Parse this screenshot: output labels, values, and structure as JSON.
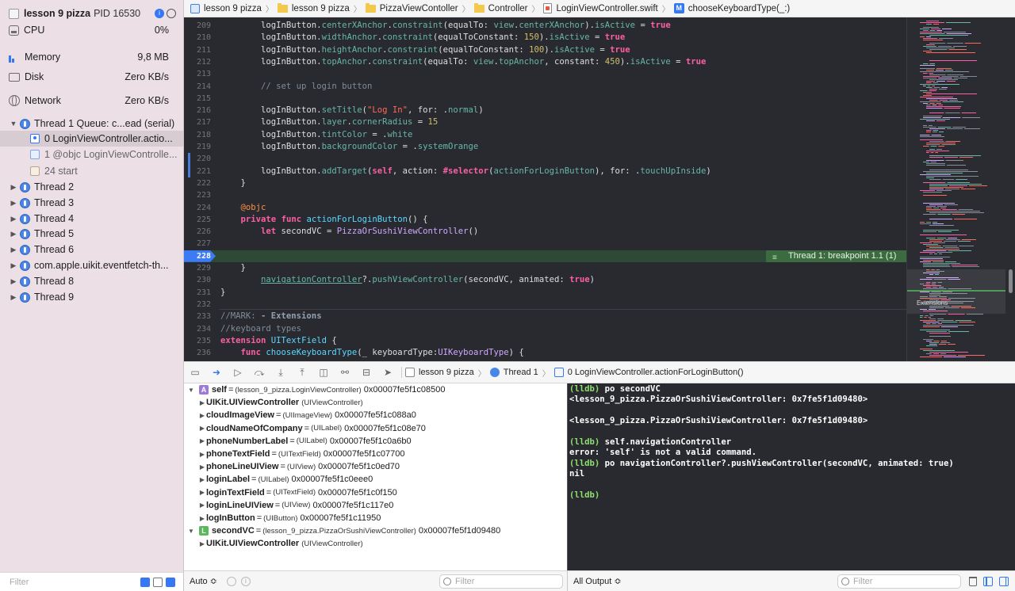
{
  "process": {
    "name": "lesson 9 pizza",
    "pid": "PID 16530"
  },
  "gauges": [
    {
      "label": "CPU",
      "value": "0%"
    },
    {
      "label": "Memory",
      "value": "9,8 MB"
    },
    {
      "label": "Disk",
      "value": "Zero KB/s"
    },
    {
      "label": "Network",
      "value": "Zero KB/s"
    }
  ],
  "threads": {
    "thread1": "Thread 1 Queue: c...ead (serial)",
    "frames": [
      "0 LoginViewController.actio...",
      "1 @objc LoginViewControlle...",
      "24 start"
    ],
    "others": [
      "Thread 2",
      "Thread 3",
      "Thread 4",
      "Thread 5",
      "Thread 6",
      "com.apple.uikit.eventfetch-th...",
      "Thread 8",
      "Thread 9"
    ]
  },
  "navigator_filter": {
    "placeholder": "Filter"
  },
  "jumpbar": {
    "items": [
      "lesson 9 pizza",
      "lesson 9 pizza",
      "PizzaViewContoller",
      "Controller",
      "LoginViewController.swift",
      "chooseKeyboardType(_:)"
    ]
  },
  "breakpoint": {
    "line": "228",
    "label": "Thread 1: breakpoint 1.1 (1)"
  },
  "code_lines": [
    {
      "n": "209",
      "t": "        logInButton.centerXAnchor.constraint(equalTo: view.centerXAnchor).isActive = true"
    },
    {
      "n": "210",
      "t": "        logInButton.widthAnchor.constraint(equalToConstant: 150).isActive = true"
    },
    {
      "n": "211",
      "t": "        logInButton.heightAnchor.constraint(equalToConstant: 100).isActive = true"
    },
    {
      "n": "212",
      "t": "        logInButton.topAnchor.constraint(equalTo: view.topAnchor, constant: 450).isActive = true"
    },
    {
      "n": "213",
      "t": ""
    },
    {
      "n": "214",
      "t": "        // set up login button"
    },
    {
      "n": "215",
      "t": ""
    },
    {
      "n": "216",
      "t": "        logInButton.setTitle(\"Log In\", for: .normal)"
    },
    {
      "n": "217",
      "t": "        logInButton.layer.cornerRadius = 15"
    },
    {
      "n": "218",
      "t": "        logInButton.tintColor = .white"
    },
    {
      "n": "219",
      "t": "        logInButton.backgroundColor = .systemOrange"
    },
    {
      "n": "220",
      "t": ""
    },
    {
      "n": "221",
      "t": "        logInButton.addTarget(self, action: #selector(actionForLoginButton), for: .touchUpInside)"
    },
    {
      "n": "222",
      "t": "    }"
    },
    {
      "n": "223",
      "t": ""
    },
    {
      "n": "224",
      "t": "    @objc"
    },
    {
      "n": "225",
      "t": "    private func actionForLoginButton() {"
    },
    {
      "n": "226",
      "t": "        let secondVC = PizzaOrSushiViewController()"
    },
    {
      "n": "227",
      "t": ""
    },
    {
      "n": "228",
      "t": "        navigationController?.pushViewController(secondVC, animated: true)"
    },
    {
      "n": "229",
      "t": "    }"
    },
    {
      "n": "230",
      "t": ""
    },
    {
      "n": "231",
      "t": "}"
    },
    {
      "n": "232",
      "t": ""
    },
    {
      "n": "233",
      "t": "//MARK: - Extensions"
    },
    {
      "n": "234",
      "t": "//keyboard types"
    },
    {
      "n": "235",
      "t": "extension UITextField {"
    },
    {
      "n": "236",
      "t": "    func chooseKeyboardType(_ keyboardType:UIKeyboardType) {"
    }
  ],
  "minimap": {
    "section_label": "Extensions"
  },
  "debugbar": {
    "crumbs": [
      "lesson 9 pizza",
      "Thread 1",
      "0 LoginViewController.actionForLoginButton()"
    ]
  },
  "variables": [
    {
      "name": "self",
      "type": "(lesson_9_pizza.LoginViewController)",
      "addr": "0x00007fe5f1c08500",
      "badge": "A",
      "level": 0,
      "open": true
    },
    {
      "name": "UIKit.UIViewController",
      "type": "(UIViewController)",
      "addr": "",
      "level": 1
    },
    {
      "name": "cloudImageView",
      "type": "(UIImageView)",
      "addr": "0x00007fe5f1c088a0",
      "level": 1
    },
    {
      "name": "cloudNameOfCompany",
      "type": "(UILabel)",
      "addr": "0x00007fe5f1c08e70",
      "level": 1
    },
    {
      "name": "phoneNumberLabel",
      "type": "(UILabel)",
      "addr": "0x00007fe5f1c0a6b0",
      "level": 1
    },
    {
      "name": "phoneTextField",
      "type": "(UITextField)",
      "addr": "0x00007fe5f1c07700",
      "level": 1
    },
    {
      "name": "phoneLineUIView",
      "type": "(UIView)",
      "addr": "0x00007fe5f1c0ed70",
      "level": 1
    },
    {
      "name": "loginLabel",
      "type": "(UILabel)",
      "addr": "0x00007fe5f1c0eee0",
      "level": 1
    },
    {
      "name": "loginTextField",
      "type": "(UITextField)",
      "addr": "0x00007fe5f1c0f150",
      "level": 1
    },
    {
      "name": "loginLineUIView",
      "type": "(UIView)",
      "addr": "0x00007fe5f1c117e0",
      "level": 1
    },
    {
      "name": "logInButton",
      "type": "(UIButton)",
      "addr": "0x00007fe5f1c11950",
      "level": 1
    },
    {
      "name": "secondVC",
      "type": "(lesson_9_pizza.PizzaOrSushiViewController)",
      "addr": "0x00007fe5f1d09480",
      "badge": "L",
      "level": 0,
      "open": true
    },
    {
      "name": "UIKit.UIViewController",
      "type": "(UIViewController)",
      "addr": "",
      "level": 1
    }
  ],
  "var_footer": {
    "scope": "Auto ≎",
    "filter_placeholder": "Filter"
  },
  "console": {
    "lines": [
      {
        "prompt": "(lldb)",
        "text": " po secondVC"
      },
      {
        "prompt": "",
        "text": "<lesson_9_pizza.PizzaOrSushiViewController: 0x7fe5f1d09480>"
      },
      {
        "prompt": "",
        "text": ""
      },
      {
        "prompt": "",
        "text": "<lesson_9_pizza.PizzaOrSushiViewController: 0x7fe5f1d09480>"
      },
      {
        "prompt": "",
        "text": ""
      },
      {
        "prompt": "(lldb)",
        "text": " self.navigationController"
      },
      {
        "prompt": "",
        "text": "error: 'self' is not a valid command."
      },
      {
        "prompt": "(lldb)",
        "text": " po navigationController?.pushViewController(secondVC, animated: true)"
      },
      {
        "prompt": "",
        "text": "nil"
      },
      {
        "prompt": "",
        "text": ""
      },
      {
        "prompt": "(lldb)",
        "text": ""
      }
    ]
  },
  "con_footer": {
    "output_selector": "All Output ≎",
    "filter_placeholder": "Filter"
  },
  "colors": {
    "accent": "#3478f6",
    "editor_bg": "#292a30",
    "breakpoint_banner": "#3b6b3e",
    "navigator_bg": "#ecdfe6"
  }
}
